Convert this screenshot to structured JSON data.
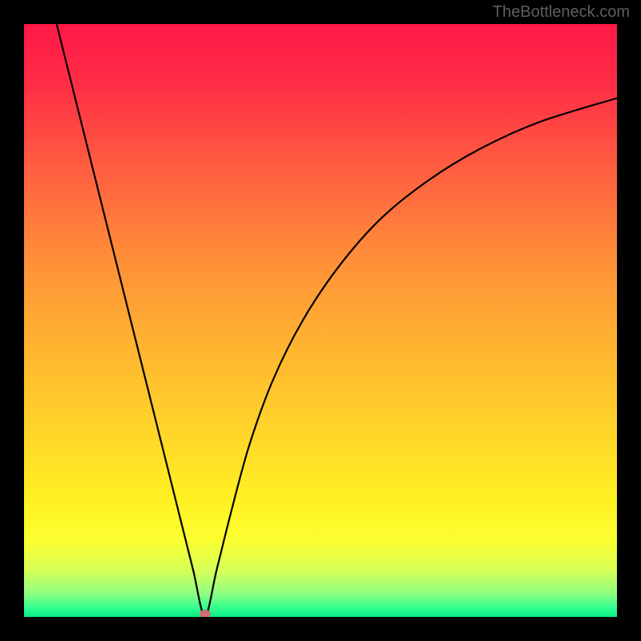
{
  "watermark": "TheBottleneck.com",
  "gradient": {
    "stops": [
      {
        "offset": 0,
        "color": "#ff1847"
      },
      {
        "offset": 0.1,
        "color": "#ff2d45"
      },
      {
        "offset": 0.25,
        "color": "#ff6040"
      },
      {
        "offset": 0.4,
        "color": "#ff9038"
      },
      {
        "offset": 0.55,
        "color": "#ffb530"
      },
      {
        "offset": 0.7,
        "color": "#ffd828"
      },
      {
        "offset": 0.8,
        "color": "#fff022"
      },
      {
        "offset": 0.87,
        "color": "#fcff30"
      },
      {
        "offset": 0.92,
        "color": "#d8ff55"
      },
      {
        "offset": 0.96,
        "color": "#90ff80"
      },
      {
        "offset": 0.985,
        "color": "#30ff90"
      },
      {
        "offset": 1.0,
        "color": "#08eb85"
      }
    ]
  },
  "chart_data": {
    "type": "line",
    "title": "",
    "xlabel": "",
    "ylabel": "",
    "xlim": [
      0,
      100
    ],
    "ylim": [
      0,
      100
    ],
    "grid": false,
    "optimum_x": 30.5,
    "points": [
      {
        "x": 5.5,
        "y": 100
      },
      {
        "x": 8,
        "y": 90
      },
      {
        "x": 11,
        "y": 78
      },
      {
        "x": 14,
        "y": 66
      },
      {
        "x": 17,
        "y": 54
      },
      {
        "x": 20,
        "y": 42
      },
      {
        "x": 23,
        "y": 30
      },
      {
        "x": 26,
        "y": 18
      },
      {
        "x": 28.5,
        "y": 8
      },
      {
        "x": 30.5,
        "y": 0.2
      },
      {
        "x": 32.5,
        "y": 8
      },
      {
        "x": 35,
        "y": 18
      },
      {
        "x": 38,
        "y": 29
      },
      {
        "x": 42,
        "y": 40
      },
      {
        "x": 47,
        "y": 50
      },
      {
        "x": 53,
        "y": 59
      },
      {
        "x": 60,
        "y": 67
      },
      {
        "x": 68,
        "y": 73.5
      },
      {
        "x": 77,
        "y": 79
      },
      {
        "x": 87,
        "y": 83.5
      },
      {
        "x": 100,
        "y": 87.5
      }
    ],
    "marker": {
      "x": 30.5,
      "y": 0.5,
      "color": "#cf6d77"
    }
  }
}
